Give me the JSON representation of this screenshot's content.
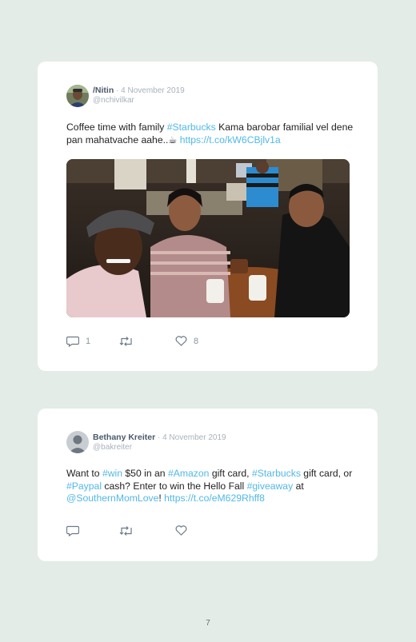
{
  "tweets": [
    {
      "name": "/Nitin",
      "date": " · 4 November 2019",
      "handle": "@nchivilkar",
      "text": [
        {
          "t": "Coffee time with family ",
          "link": false
        },
        {
          "t": "#Starbucks",
          "link": true
        },
        {
          "t": " Kama barobar familial vel dene pan mahatvache aahe..☕ ",
          "link": false
        },
        {
          "t": "https://t.co/kW6CBjlv1a",
          "link": true
        }
      ],
      "replies": "1",
      "retweets": "",
      "likes": "8"
    },
    {
      "name": "Bethany Kreiter",
      "date": " · 4 November 2019",
      "handle": "@bakreiter",
      "text": [
        {
          "t": "Want to ",
          "link": false
        },
        {
          "t": "#win",
          "link": true
        },
        {
          "t": " $50 in an ",
          "link": false
        },
        {
          "t": "#Amazon",
          "link": true
        },
        {
          "t": " gift card, ",
          "link": false
        },
        {
          "t": "#Starbucks",
          "link": true
        },
        {
          "t": " gift card, or ",
          "link": false
        },
        {
          "t": "#Paypal",
          "link": true
        },
        {
          "t": " cash? Enter to win the Hello Fall ",
          "link": false
        },
        {
          "t": "#giveaway",
          "link": true
        },
        {
          "t": " at ",
          "link": false
        },
        {
          "t": "@SouthernMomLove",
          "link": true
        },
        {
          "t": "! ",
          "link": false
        },
        {
          "t": "https://t.co/eM629Rhff8",
          "link": true
        }
      ],
      "replies": "",
      "retweets": "",
      "likes": ""
    }
  ],
  "page_number": "7",
  "icons": {
    "reply": "reply-icon",
    "retweet": "retweet-icon",
    "like": "heart-icon"
  },
  "colors": {
    "background": "#e3ece6",
    "card": "#ffffff",
    "link": "#52b8e8",
    "name": "#4a5a6b",
    "muted": "#a8b2bb"
  }
}
